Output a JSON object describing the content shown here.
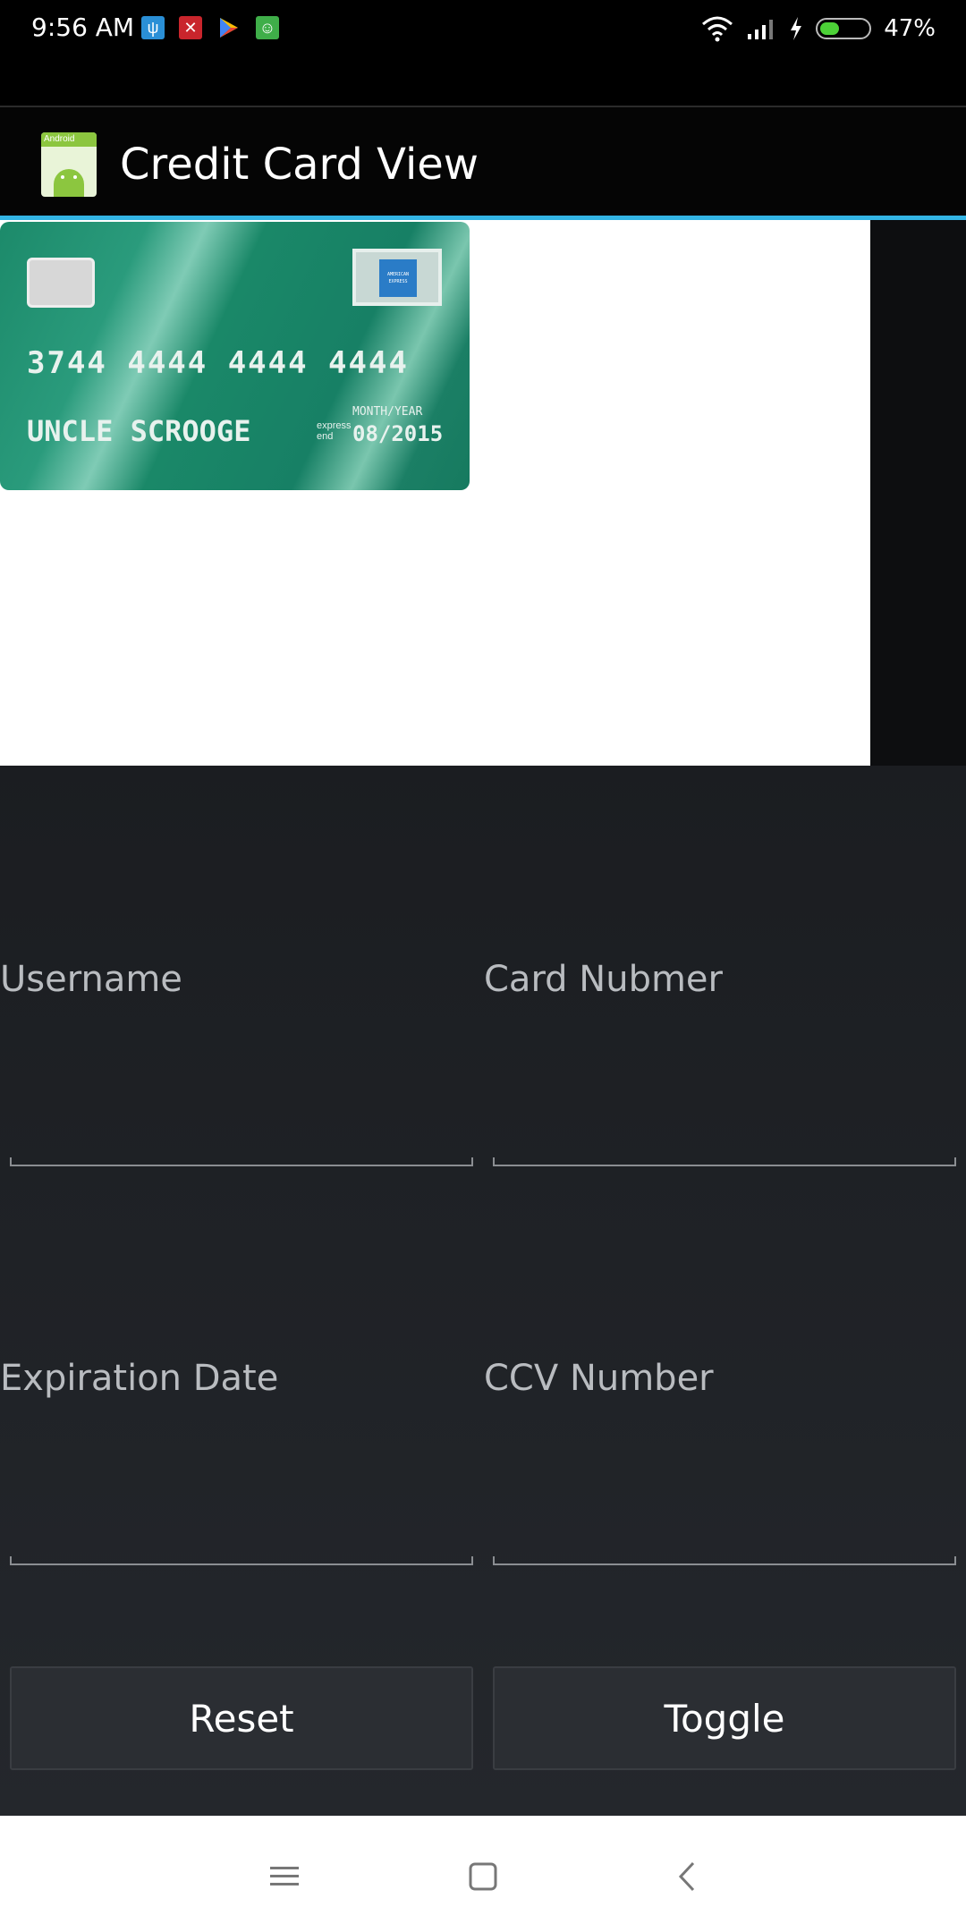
{
  "status_bar": {
    "time": "9:56 AM",
    "battery_percent": "47%",
    "battery_level": 0.47,
    "notification_icons": [
      "usb-icon",
      "app-notification-icon",
      "play-store-icon",
      "android-debug-icon"
    ]
  },
  "app_bar": {
    "title": "Credit Card View",
    "icon": "android-app-icon",
    "icon_band_text": "Android"
  },
  "card": {
    "number": "3744 4444 4444 4444",
    "name": "UNCLE SCROOGE",
    "expiry_label": "MONTH/YEAR",
    "expiry_prefix_line1": "express",
    "expiry_prefix_line2": "end",
    "expiry": "08/2015",
    "brand_text": "AMERICAN EXPRESS"
  },
  "form": {
    "username_label": "Username",
    "card_number_label": "Card Nubmer",
    "expiration_label": "Expiration Date",
    "ccv_label": "CCV Number",
    "username_value": "",
    "card_number_value": "",
    "expiration_value": "",
    "ccv_value": ""
  },
  "buttons": {
    "reset": "Reset",
    "toggle": "Toggle"
  },
  "nav_bar": {
    "icons": [
      "menu-icon",
      "home-icon",
      "back-icon"
    ]
  },
  "colors": {
    "accent": "#33b5e5",
    "card_green": "#1a8868",
    "battery": "#4cd137"
  }
}
